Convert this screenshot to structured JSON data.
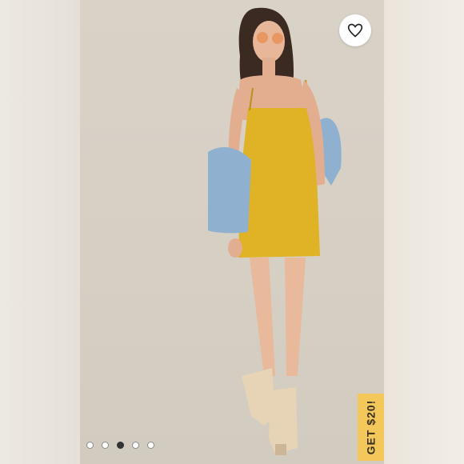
{
  "listing": {
    "promo_label": "GET $20!",
    "favorite_icon": "heart-icon",
    "carousel": {
      "total": 5,
      "active_index": 2
    }
  },
  "colors": {
    "dress": "#e0b226",
    "promo_tag": "#f4c75a",
    "background": "#d8d1c6"
  }
}
